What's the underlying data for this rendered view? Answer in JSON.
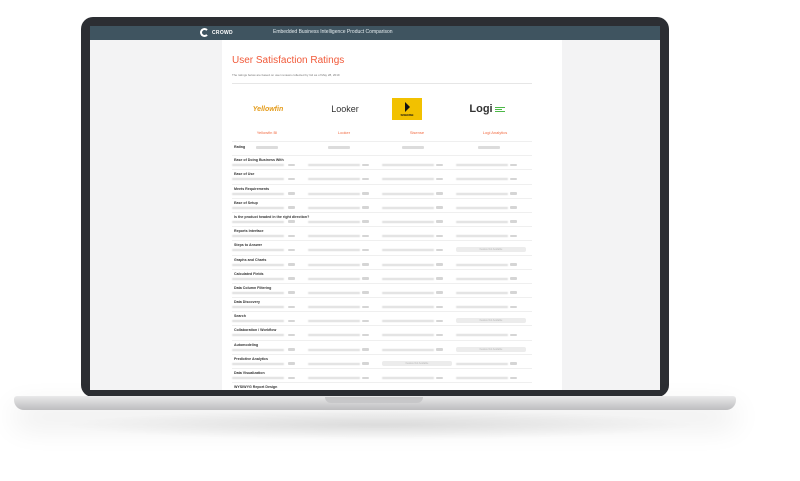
{
  "app": {
    "logo_text": "CROWD",
    "header_title": "Embedded Business Intelligence Product Comparison"
  },
  "report": {
    "title": "User Satisfaction Ratings",
    "subtitle": "The ratings below are based on user reviews collected by G2 as of May 28, 2019"
  },
  "vendors": [
    {
      "name": "Yellowfin BI",
      "logo": "Yellowfin"
    },
    {
      "name": "Looker",
      "logo": "Looker"
    },
    {
      "name": "Sisense",
      "logo": "SISENSE"
    },
    {
      "name": "Logi Analytics",
      "logo": "Logi",
      "logo_tag": "ANALYTICS"
    }
  ],
  "rating_label": "Rating",
  "na_text": "Feature Not Available",
  "rows": [
    {
      "label": "Ease of Doing Business With",
      "na": []
    },
    {
      "label": "Ease of Use",
      "na": []
    },
    {
      "label": "Meets Requirements",
      "na": []
    },
    {
      "label": "Ease of Setup",
      "na": []
    },
    {
      "label": "Is the product headed in the right direction?",
      "na": []
    },
    {
      "label": "Reports Interface",
      "na": []
    },
    {
      "label": "Steps to Answer",
      "na": [
        3
      ]
    },
    {
      "label": "Graphs and Charts",
      "na": []
    },
    {
      "label": "Calculated Fields",
      "na": []
    },
    {
      "label": "Data Column Filtering",
      "na": []
    },
    {
      "label": "Data Discovery",
      "na": []
    },
    {
      "label": "Search",
      "na": [
        3
      ]
    },
    {
      "label": "Collaboration / Workflow",
      "na": []
    },
    {
      "label": "Automodeling",
      "na": [
        3
      ]
    },
    {
      "label": "Predictive Analytics",
      "na": [
        2
      ]
    },
    {
      "label": "Data Visualization",
      "na": []
    },
    {
      "label": "WYSIWYG Report Design",
      "na": []
    }
  ]
}
